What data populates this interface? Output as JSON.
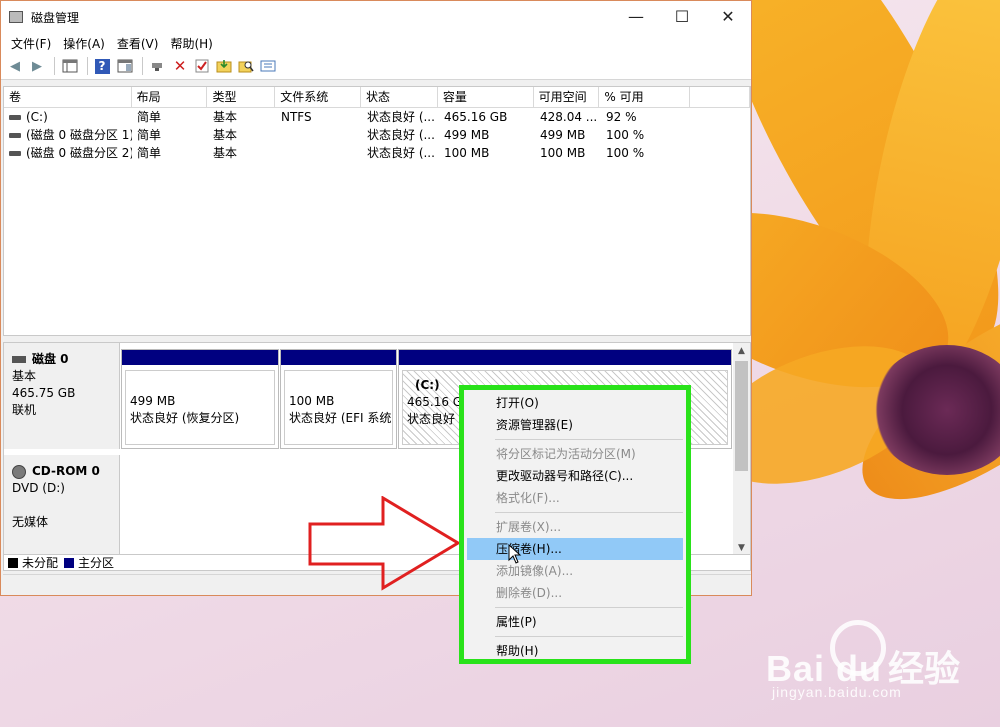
{
  "window": {
    "title": "磁盘管理",
    "controls": {
      "minimize": "—",
      "maximize": "☐",
      "close": "✕"
    }
  },
  "menubar": [
    "文件(F)",
    "操作(A)",
    "查看(V)",
    "帮助(H)"
  ],
  "volume_table": {
    "columns": [
      "卷",
      "布局",
      "类型",
      "文件系统",
      "状态",
      "容量",
      "可用空间",
      "% 可用",
      ""
    ],
    "rows": [
      [
        "(C:)",
        "简单",
        "基本",
        "NTFS",
        "状态良好 (...",
        "465.16 GB",
        "428.04 ...",
        "92 %"
      ],
      [
        "(磁盘 0 磁盘分区 1)",
        "简单",
        "基本",
        "",
        "状态良好 (...",
        "499 MB",
        "499 MB",
        "100 %"
      ],
      [
        "(磁盘 0 磁盘分区 2)",
        "简单",
        "基本",
        "",
        "状态良好 (...",
        "100 MB",
        "100 MB",
        "100 %"
      ]
    ]
  },
  "disks": {
    "disk0": {
      "name": "磁盘 0",
      "type": "基本",
      "size": "465.75 GB",
      "state": "联机"
    },
    "cdrom0": {
      "name": "CD-ROM 0",
      "drive": "DVD (D:)",
      "media": "无媒体"
    }
  },
  "partitions": [
    {
      "title": "",
      "size": "499 MB",
      "status": "状态良好 (恢复分区)"
    },
    {
      "title": "",
      "size": "100 MB",
      "status": "状态良好 (EFI 系统"
    },
    {
      "title": "(C:)",
      "size": "465.16 GB",
      "status": "状态良好 ("
    }
  ],
  "legend": {
    "unallocated": "未分配",
    "primary": "主分区",
    "unallocated_color": "#000000",
    "primary_color": "#000080"
  },
  "context_menu": {
    "items": [
      {
        "label": "打开(O)",
        "enabled": true
      },
      {
        "label": "资源管理器(E)",
        "enabled": true
      },
      {
        "label": "将分区标记为活动分区(M)",
        "enabled": false
      },
      {
        "label": "更改驱动器号和路径(C)...",
        "enabled": true
      },
      {
        "label": "格式化(F)...",
        "enabled": false
      },
      {
        "label": "扩展卷(X)...",
        "enabled": false
      },
      {
        "label": "压缩卷(H)...",
        "enabled": true,
        "highlighted": true
      },
      {
        "label": "添加镜像(A)...",
        "enabled": false
      },
      {
        "label": "删除卷(D)...",
        "enabled": false
      },
      {
        "label": "属性(P)",
        "enabled": true
      },
      {
        "label": "帮助(H)",
        "enabled": true
      }
    ],
    "border_color": "#29e21a",
    "highlight_color": "#91c9f7"
  },
  "annotation": {
    "arrow_color": "#e02020"
  },
  "watermark": {
    "brand": "Bai du",
    "sub": "经验",
    "url": "jingyan.baidu.com"
  }
}
